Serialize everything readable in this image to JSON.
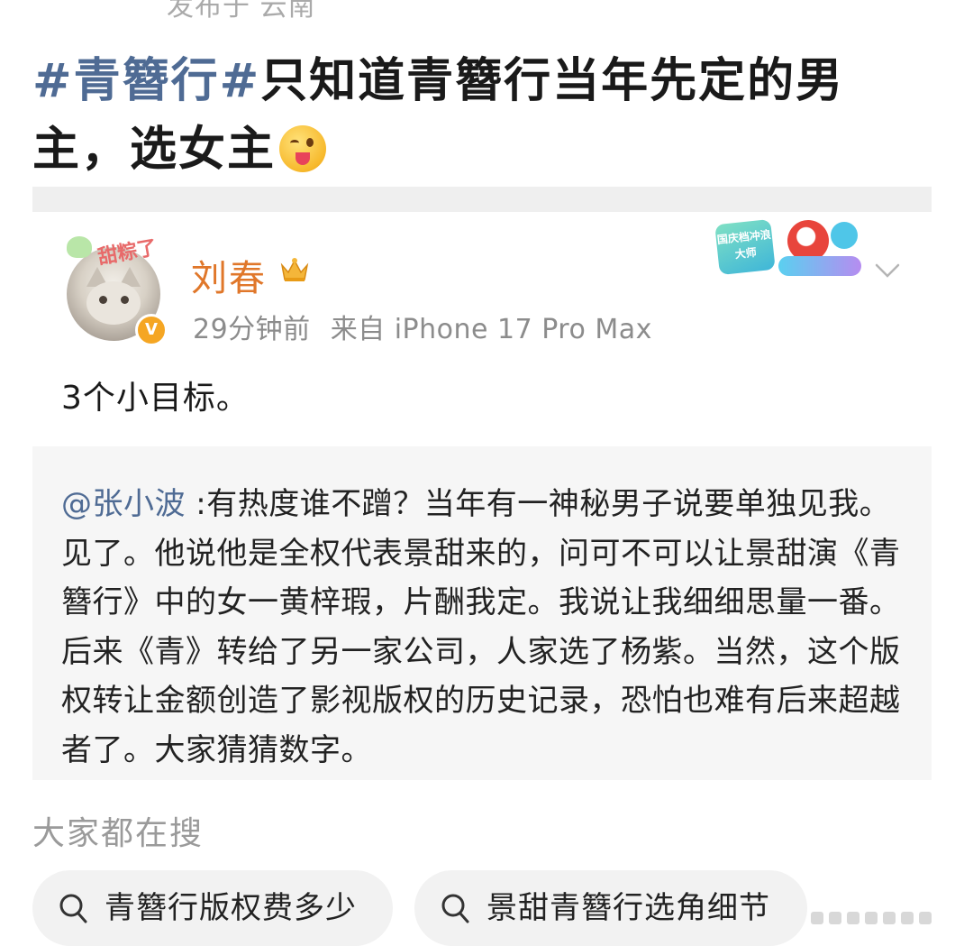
{
  "top_clip": "发布于 云南",
  "post": {
    "hashtag": "#青簪行#",
    "title_text": "只知道青簪行当年先定的男主，选女主"
  },
  "quote": {
    "author": {
      "name": "刘春",
      "verified": true,
      "avatar_sticker": "甜粽了"
    },
    "meta": {
      "time": "29分钟前",
      "source": "来自 iPhone 17 Pro Max"
    },
    "badge_text": "国庆档冲浪大师",
    "body": "3个小目标。",
    "retweet": {
      "mention": "@张小波",
      "text": " :有热度谁不蹭？当年有一神秘男子说要单独见我。见了。他说他是全权代表景甜来的，问可不可以让景甜演《青簪行》中的女一黄梓瑕，片酬我定。我说让我细细思量一番。后来《青》转给了另一家公司，人家选了杨紫。当然，这个版权转让金额创造了影视版权的历史记录，恐怕也难有后来超越者了。大家猜猜数字。"
    }
  },
  "search": {
    "heading": "大家都在搜",
    "pills": [
      "青簪行版权费多少",
      "景甜青簪行选角细节"
    ]
  },
  "colors": {
    "hashtag": "#4f6b94",
    "author_name": "#e0772a",
    "meta": "#8c8c8c",
    "retweet_bg": "#f6f6f6"
  }
}
